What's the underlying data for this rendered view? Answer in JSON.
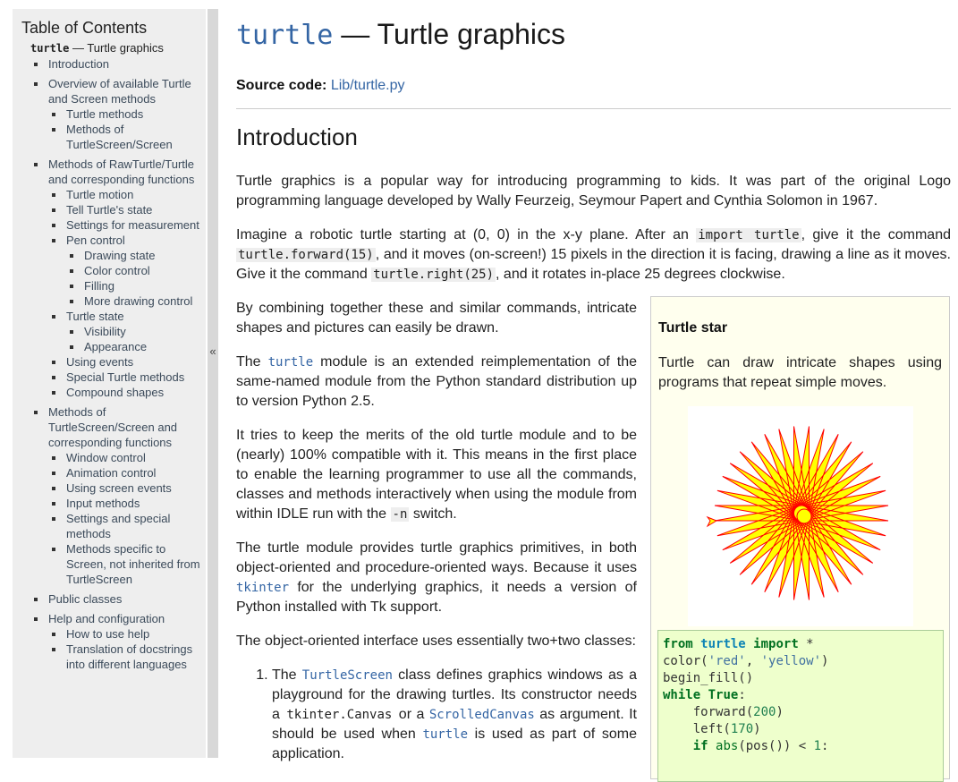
{
  "sidebar": {
    "title": "Table of Contents",
    "top_code": "turtle",
    "top_rest": " — Turtle graphics",
    "collapse": "«",
    "items": [
      {
        "label": "Introduction"
      },
      {
        "label": "Overview of available Turtle and Screen methods",
        "children": [
          {
            "label": "Turtle methods"
          },
          {
            "label": "Methods of TurtleScreen/Screen"
          }
        ]
      },
      {
        "label": "Methods of RawTurtle/Turtle and corresponding functions",
        "children": [
          {
            "label": "Turtle motion"
          },
          {
            "label": "Tell Turtle's state"
          },
          {
            "label": "Settings for measurement"
          },
          {
            "label": "Pen control",
            "children": [
              {
                "label": "Drawing state"
              },
              {
                "label": "Color control"
              },
              {
                "label": "Filling"
              },
              {
                "label": "More drawing control"
              }
            ]
          },
          {
            "label": "Turtle state",
            "children": [
              {
                "label": "Visibility"
              },
              {
                "label": "Appearance"
              }
            ]
          },
          {
            "label": "Using events"
          },
          {
            "label": "Special Turtle methods"
          },
          {
            "label": "Compound shapes"
          }
        ]
      },
      {
        "label": "Methods of TurtleScreen/Screen and corresponding functions",
        "children": [
          {
            "label": "Window control"
          },
          {
            "label": "Animation control"
          },
          {
            "label": "Using screen events"
          },
          {
            "label": "Input methods"
          },
          {
            "label": "Settings and special methods"
          },
          {
            "label": "Methods specific to Screen, not inherited from TurtleScreen"
          }
        ]
      },
      {
        "label": "Public classes"
      },
      {
        "label": "Help and configuration",
        "children": [
          {
            "label": "How to use help"
          },
          {
            "label": "Translation of docstrings into different languages"
          }
        ]
      }
    ]
  },
  "main": {
    "title_code": "turtle",
    "title_rest": " — Turtle graphics",
    "source_label": "Source code:",
    "source_link": "Lib/turtle.py",
    "section_title": "Introduction",
    "p1": "Turtle graphics is a popular way for introducing programming to kids. It was part of the original Logo programming language developed by Wally Feurzeig, Seymour Papert and Cynthia Solomon in 1967.",
    "p2_a": "Imagine a robotic turtle starting at (0, 0) in the x-y plane. After an ",
    "p2_code1": "import turtle",
    "p2_b": ", give it the command ",
    "p2_code2": "turtle.forward(15)",
    "p2_c": ", and it moves (on-screen!) 15 pixels in the direction it is facing, drawing a line as it moves. Give it the command ",
    "p2_code3": "turtle.right(25)",
    "p2_d": ", and it rotates in-place 25 degrees clockwise.",
    "p3": "By combining together these and similar commands, intricate shapes and pictures can easily be drawn.",
    "p4_a": "The ",
    "p4_code": "turtle",
    "p4_b": " module is an extended reimplementation of the same-named module from the Python standard distribution up to version Python 2.5.",
    "p5_a": "It tries to keep the merits of the old turtle module and to be (nearly) 100% compatible with it. This means in the first place to enable the learning programmer to use all the commands, classes and methods interactively when using the module from within IDLE run with the ",
    "p5_code": "-n",
    "p5_b": " switch.",
    "p6_a": "The turtle module provides turtle graphics primitives, in both object-oriented and procedure-oriented ways. Because it uses ",
    "p6_code": "tkinter",
    "p6_b": " for the underlying graphics, it needs a version of Python installed with Tk support.",
    "p7": "The object-oriented interface uses essentially two+two classes:",
    "li1_a": "The ",
    "li1_code1": "TurtleScreen",
    "li1_b": " class defines graphics windows as a playground for the drawing turtles. Its constructor needs a ",
    "li1_code2": "tkinter.Canvas",
    "li1_c": " or a ",
    "li1_code3": "ScrolledCanvas",
    "li1_d": " as argument. It should be used when ",
    "li1_code4": "turtle",
    "li1_e": " is used as part of some application."
  },
  "star_box": {
    "title": "Turtle star",
    "text": "Turtle can draw intricate shapes using programs that repeat simple moves.",
    "colors": {
      "line": "#ff0000",
      "fill": "#ffff00",
      "turtle": "#ffff00"
    }
  },
  "code": {
    "lines": [
      "from turtle import *",
      "color('red', 'yellow')",
      "begin_fill()",
      "while True:",
      "    forward(200)",
      "    left(170)",
      "    if abs(pos()) < 1:"
    ]
  }
}
